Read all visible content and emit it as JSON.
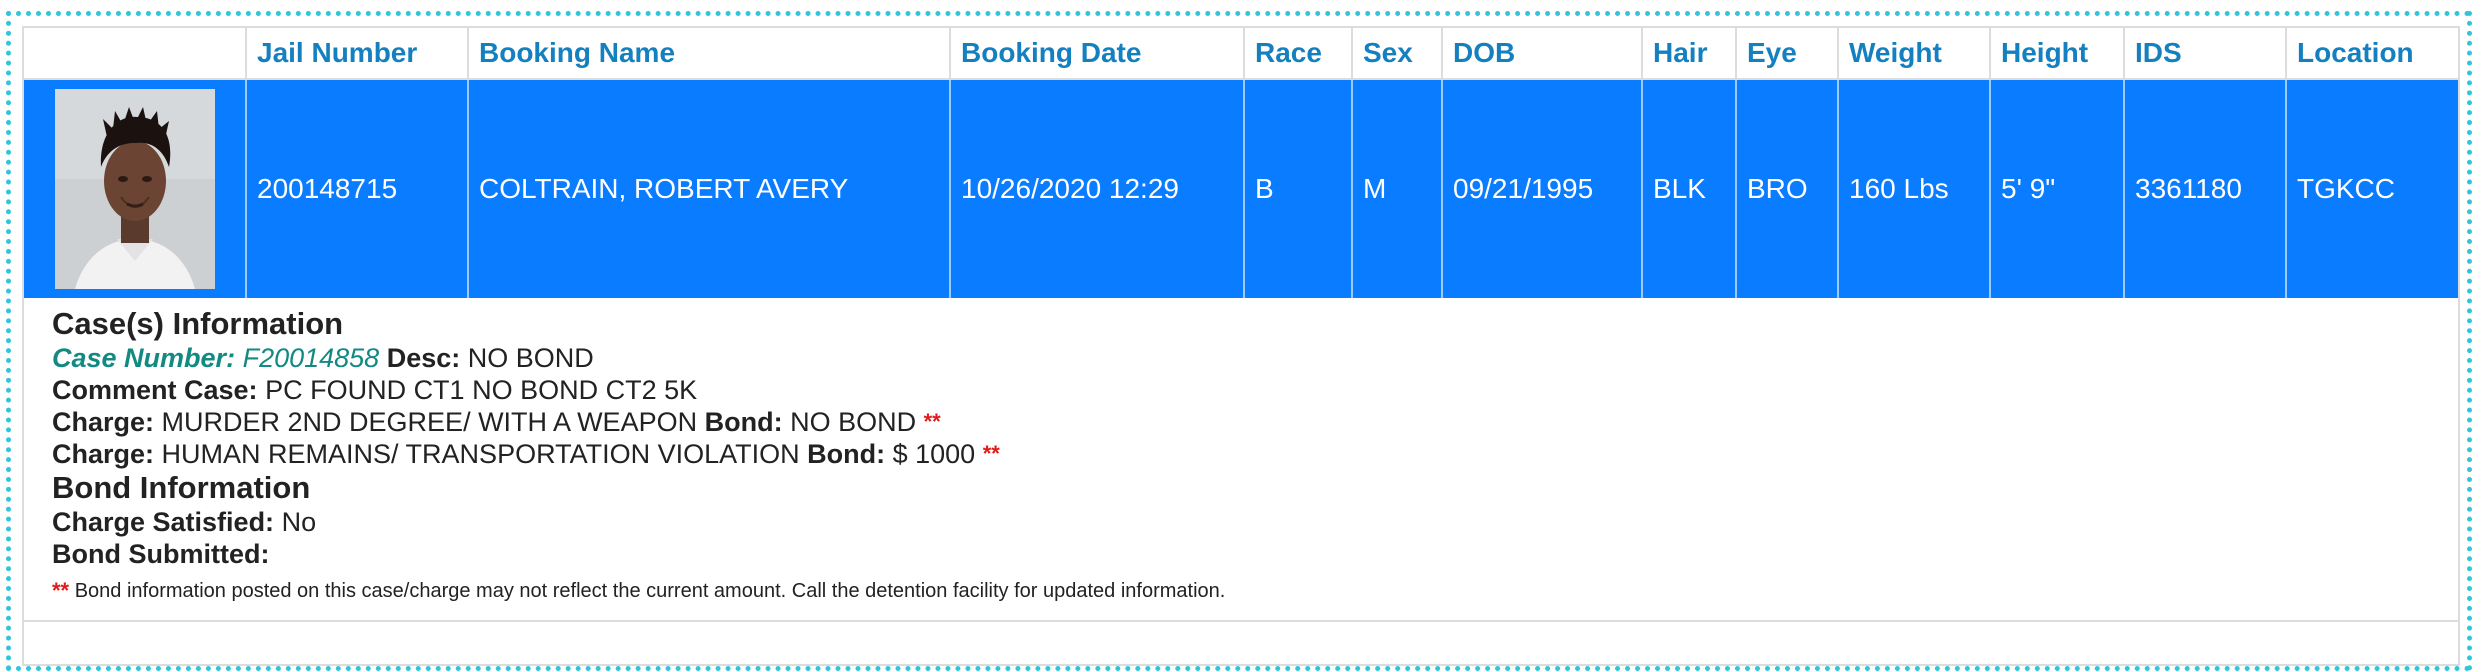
{
  "table": {
    "headers": {
      "photo": "",
      "jail_number": "Jail Number",
      "booking_name": "Booking Name",
      "booking_date": "Booking Date",
      "race": "Race",
      "sex": "Sex",
      "dob": "DOB",
      "hair": "Hair",
      "eye": "Eye",
      "weight": "Weight",
      "height": "Height",
      "ids": "IDS",
      "location": "Location"
    },
    "row": {
      "jail_number": "200148715",
      "booking_name": "COLTRAIN, ROBERT AVERY",
      "booking_date": "10/26/2020 12:29",
      "race": "B",
      "sex": "M",
      "dob": "09/21/1995",
      "hair": "BLK",
      "eye": "BRO",
      "weight": "160 Lbs",
      "height": "5' 9\"",
      "ids": "3361180",
      "location": "TGKCC"
    }
  },
  "cases": {
    "heading": "Case(s) Information",
    "case_number_label": "Case Number:",
    "case_number": "F20014858",
    "desc_label": "Desc:",
    "desc": "NO BOND",
    "comment_label": "Comment Case:",
    "comment": "PC FOUND CT1 NO BOND CT2 5K",
    "charges": [
      {
        "label": "Charge:",
        "charge": "MURDER 2ND DEGREE/ WITH A WEAPON",
        "bond_label": "Bond:",
        "bond": "NO BOND",
        "marker": "**"
      },
      {
        "label": "Charge:",
        "charge": "HUMAN REMAINS/ TRANSPORTATION VIOLATION",
        "bond_label": "Bond:",
        "bond": "$ 1000",
        "marker": "**"
      }
    ]
  },
  "bond_info": {
    "heading": "Bond Information",
    "satisfied_label": "Charge Satisfied:",
    "satisfied": "No",
    "submitted_label": "Bond Submitted:",
    "submitted": ""
  },
  "note": {
    "marker": "**",
    "text": "Bond information posted on this case/charge may not reflect the current amount. Call the detention facility for updated information."
  },
  "colors": {
    "accent_frame": "#2fc6dc",
    "header_text": "#1580c0",
    "row_highlight": "#0a7cff",
    "case_text": "#128a82",
    "marker": "#e01b1b"
  }
}
